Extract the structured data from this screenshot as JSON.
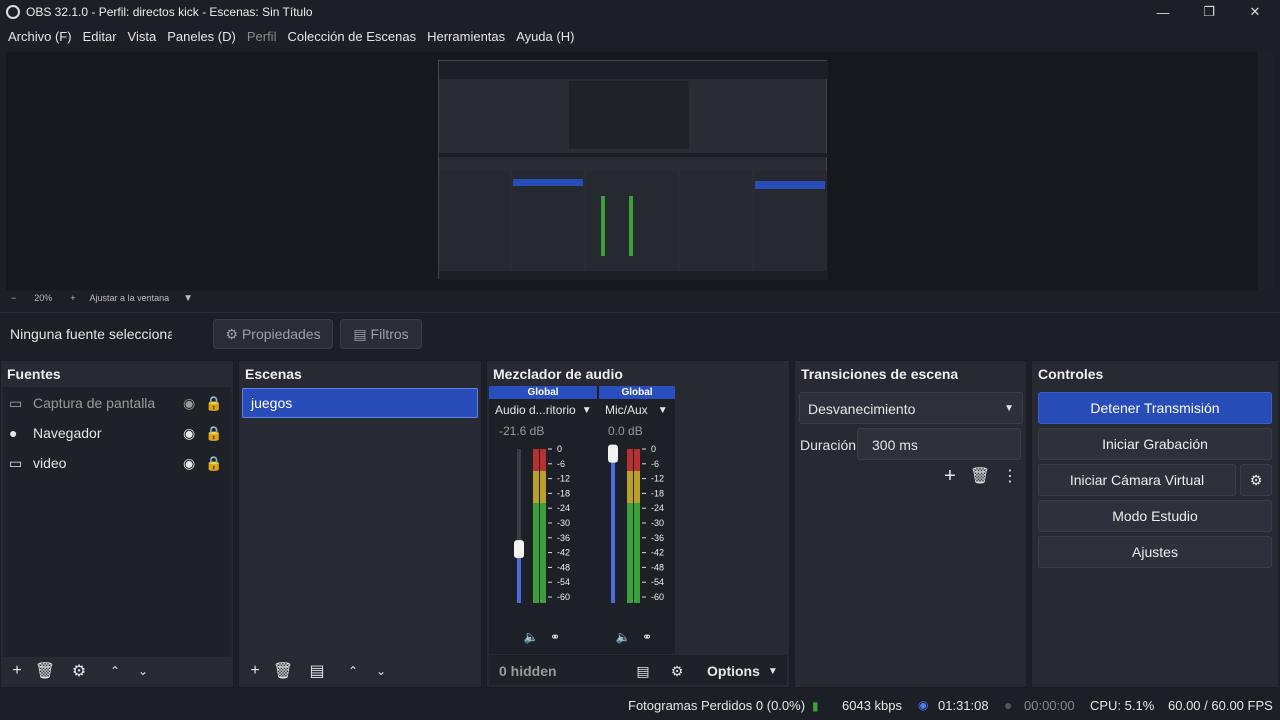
{
  "window": {
    "title": "OBS 32.1.0 - Perfil: directos kick - Escenas: Sin Título"
  },
  "menu": [
    "Archivo (F)",
    "Editar",
    "Vista",
    "Paneles (D)",
    "Perfil",
    "Colección de Escenas",
    "Herramientas",
    "Ayuda (H)"
  ],
  "zoom": {
    "minus": "−",
    "value": "20%",
    "plus": "+",
    "fit": "Ajustar a la ventana"
  },
  "source_bar": {
    "label": "Ninguna fuente seleccionada",
    "properties": "Propiedades",
    "filters": "Filtros"
  },
  "sources": {
    "title": "Fuentes",
    "items": [
      {
        "label": "Captura de pantalla",
        "icon": "monitor-icon",
        "visible": false
      },
      {
        "label": "Navegador",
        "icon": "globe-icon",
        "visible": true
      },
      {
        "label": "video",
        "icon": "monitor-icon",
        "visible": true
      }
    ]
  },
  "scenes": {
    "title": "Escenas",
    "items": [
      "juegos"
    ]
  },
  "mixer": {
    "title": "Mezclador de audio",
    "channels": [
      {
        "header": "Global",
        "name": "Audio d...ritorio",
        "db": "-21.6 dB",
        "level": 0.35
      },
      {
        "header": "Global",
        "name": "Mic/Aux",
        "db": "0.0 dB",
        "level": 0.97
      }
    ],
    "ticks": [
      "0",
      "-6",
      "-12",
      "-18",
      "-24",
      "-30",
      "-36",
      "-42",
      "-48",
      "-54",
      "-60"
    ],
    "hidden": "0 hidden",
    "options": "Options"
  },
  "transitions": {
    "title": "Transiciones de escena",
    "selected": "Desvanecimiento",
    "duration_label": "Duración",
    "duration_value": "300 ms"
  },
  "controls": {
    "title": "Controles",
    "stop_stream": "Detener Transmisión",
    "start_record": "Iniciar Grabación",
    "virtual_cam": "Iniciar Cámara Virtual",
    "studio": "Modo Estudio",
    "settings": "Ajustes"
  },
  "status": {
    "dropped": "Fotogramas Perdidos 0 (0.0%)",
    "bitrate": "6043 kbps",
    "stream_time": "01:31:08",
    "rec_time": "00:00:00",
    "cpu": "CPU: 5.1%",
    "fps": "60.00 / 60.00 FPS"
  },
  "colors": {
    "accent": "#284cb8",
    "meter_green": "#3aa13a",
    "meter_yellow": "#b8a02a",
    "meter_red": "#b83030"
  }
}
